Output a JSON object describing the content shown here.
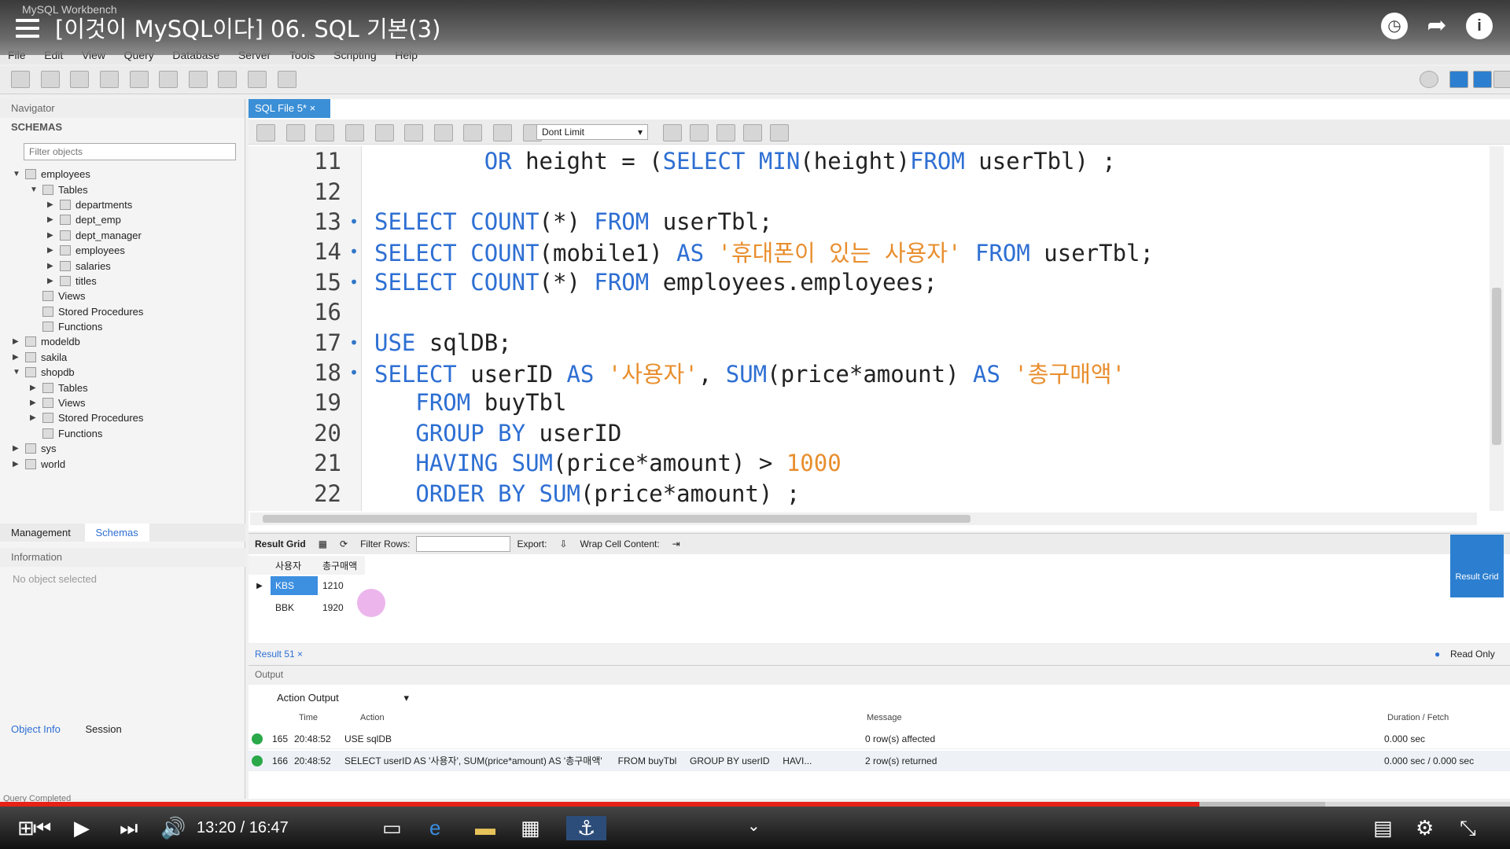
{
  "window": {
    "app_name": "MySQL Workbench",
    "video_title": "[이것이 MySQL이다] 06. SQL 기본(3)"
  },
  "menu": [
    "File",
    "Edit",
    "View",
    "Query",
    "Database",
    "Server",
    "Tools",
    "Scripting",
    "Help"
  ],
  "navigator": {
    "header": "Navigator",
    "schemas_label": "SCHEMAS",
    "filter_placeholder": "Filter objects",
    "tree": [
      {
        "label": "employees",
        "depth": 0,
        "arrow": "▼"
      },
      {
        "label": "Tables",
        "depth": 1,
        "arrow": "▼"
      },
      {
        "label": "departments",
        "depth": 2,
        "arrow": "▶"
      },
      {
        "label": "dept_emp",
        "depth": 2,
        "arrow": "▶"
      },
      {
        "label": "dept_manager",
        "depth": 2,
        "arrow": "▶"
      },
      {
        "label": "employees",
        "depth": 2,
        "arrow": "▶"
      },
      {
        "label": "salaries",
        "depth": 2,
        "arrow": "▶"
      },
      {
        "label": "titles",
        "depth": 2,
        "arrow": "▶"
      },
      {
        "label": "Views",
        "depth": 1,
        "arrow": ""
      },
      {
        "label": "Stored Procedures",
        "depth": 1,
        "arrow": ""
      },
      {
        "label": "Functions",
        "depth": 1,
        "arrow": ""
      },
      {
        "label": "modeldb",
        "depth": 0,
        "arrow": "▶"
      },
      {
        "label": "sakila",
        "depth": 0,
        "arrow": "▶"
      },
      {
        "label": "shopdb",
        "depth": 0,
        "arrow": "▼"
      },
      {
        "label": "Tables",
        "depth": 1,
        "arrow": "▶"
      },
      {
        "label": "Views",
        "depth": 1,
        "arrow": "▶"
      },
      {
        "label": "Stored Procedures",
        "depth": 1,
        "arrow": "▶"
      },
      {
        "label": "Functions",
        "depth": 1,
        "arrow": ""
      },
      {
        "label": "sys",
        "depth": 0,
        "arrow": "▶"
      },
      {
        "label": "world",
        "depth": 0,
        "arrow": "▶"
      }
    ],
    "tab_management": "Management",
    "tab_schemas": "Schemas",
    "info_header": "Information",
    "info_text": "No object selected",
    "tab_object_info": "Object Info",
    "tab_session": "Session"
  },
  "editor": {
    "tab_label": "SQL File 5*",
    "limit_select": "Dont Limit",
    "lines": [
      {
        "n": "11",
        "dot": false,
        "tokens": [
          [
            "        ",
            "id"
          ],
          [
            "OR",
            "kw"
          ],
          [
            " height = (",
            "id"
          ],
          [
            "SELECT",
            "kw"
          ],
          [
            " ",
            "id"
          ],
          [
            "MIN",
            "fn"
          ],
          [
            "(height)",
            "id"
          ],
          [
            "FROM",
            "kw"
          ],
          [
            " userTbl) ;",
            "id"
          ]
        ]
      },
      {
        "n": "12",
        "dot": false,
        "tokens": []
      },
      {
        "n": "13",
        "dot": true,
        "tokens": [
          [
            "SELECT",
            "kw"
          ],
          [
            " ",
            "id"
          ],
          [
            "COUNT",
            "fn"
          ],
          [
            "(*) ",
            "id"
          ],
          [
            "FROM",
            "kw"
          ],
          [
            " userTbl;",
            "id"
          ]
        ]
      },
      {
        "n": "14",
        "dot": true,
        "tokens": [
          [
            "SELECT",
            "kw"
          ],
          [
            " ",
            "id"
          ],
          [
            "COUNT",
            "fn"
          ],
          [
            "(mobile1) ",
            "id"
          ],
          [
            "AS",
            "kw"
          ],
          [
            " ",
            "id"
          ],
          [
            "'휴대폰이 있는 사용자'",
            "str"
          ],
          [
            " ",
            "id"
          ],
          [
            "FROM",
            "kw"
          ],
          [
            " userTbl;",
            "id"
          ]
        ]
      },
      {
        "n": "15",
        "dot": true,
        "tokens": [
          [
            "SELECT",
            "kw"
          ],
          [
            " ",
            "id"
          ],
          [
            "COUNT",
            "fn"
          ],
          [
            "(*) ",
            "id"
          ],
          [
            "FROM",
            "kw"
          ],
          [
            " employees.employees;",
            "id"
          ]
        ]
      },
      {
        "n": "16",
        "dot": false,
        "tokens": []
      },
      {
        "n": "17",
        "dot": true,
        "tokens": [
          [
            "USE",
            "kw"
          ],
          [
            " sqlDB;",
            "id"
          ]
        ]
      },
      {
        "n": "18",
        "dot": true,
        "tokens": [
          [
            "SELECT",
            "kw"
          ],
          [
            " userID ",
            "id"
          ],
          [
            "AS",
            "kw"
          ],
          [
            " ",
            "id"
          ],
          [
            "'사용자'",
            "str"
          ],
          [
            ", ",
            "id"
          ],
          [
            "SUM",
            "fn"
          ],
          [
            "(price*amount) ",
            "id"
          ],
          [
            "AS",
            "kw"
          ],
          [
            " ",
            "id"
          ],
          [
            "'총구매액'",
            "str"
          ]
        ]
      },
      {
        "n": "19",
        "dot": false,
        "tokens": [
          [
            "   ",
            "id"
          ],
          [
            "FROM",
            "kw"
          ],
          [
            " buyTbl",
            "id"
          ]
        ]
      },
      {
        "n": "20",
        "dot": false,
        "tokens": [
          [
            "   ",
            "id"
          ],
          [
            "GROUP BY",
            "kw"
          ],
          [
            " userID",
            "id"
          ]
        ]
      },
      {
        "n": "21",
        "dot": false,
        "tokens": [
          [
            "   ",
            "id"
          ],
          [
            "HAVING",
            "kw"
          ],
          [
            " ",
            "id"
          ],
          [
            "SUM",
            "fn"
          ],
          [
            "(price*amount) > ",
            "id"
          ],
          [
            "1000",
            "num"
          ]
        ]
      },
      {
        "n": "22",
        "dot": false,
        "tokens": [
          [
            "   ",
            "id"
          ],
          [
            "ORDER BY",
            "kw"
          ],
          [
            " ",
            "id"
          ],
          [
            "SUM",
            "fn"
          ],
          [
            "(price*amount) ;",
            "id"
          ]
        ]
      }
    ]
  },
  "result": {
    "grid_label": "Result Grid",
    "filter_label": "Filter Rows:",
    "export_label": "Export:",
    "wrap_label": "Wrap Cell Content:",
    "columns": [
      "사용자",
      "총구매액"
    ],
    "rows": [
      [
        "KBS",
        "1210"
      ],
      [
        "BBK",
        "1920"
      ]
    ],
    "side_button": "Result Grid",
    "tab_label": "Result 51",
    "read_only": "Read Only"
  },
  "output": {
    "header": "Output",
    "select_value": "Action Output",
    "columns": [
      "Time",
      "Action",
      "Message",
      "Duration / Fetch"
    ],
    "rows": [
      {
        "num": "165",
        "time": "20:48:52",
        "action": "USE sqlDB",
        "message": "0 row(s) affected",
        "duration": "0.000 sec"
      },
      {
        "num": "166",
        "time": "20:48:52",
        "action": "SELECT userID AS '사용자', SUM(price*amount) AS '총구매액'      FROM buyTbl     GROUP BY userID     HAVI...",
        "message": "2 row(s) returned",
        "duration": "0.000 sec / 0.000 sec"
      }
    ]
  },
  "status": {
    "text": "Query Completed"
  },
  "video": {
    "time_current": "13:20",
    "time_separator": "/",
    "time_total": "16:47",
    "progress": 0.7945
  }
}
